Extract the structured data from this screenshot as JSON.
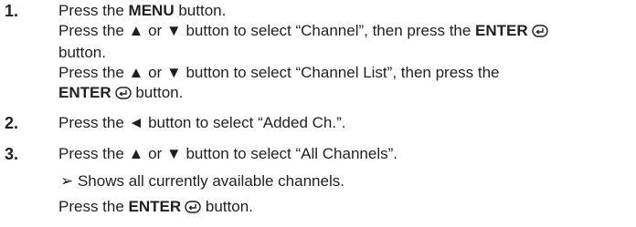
{
  "steps": [
    {
      "number": "1.",
      "lines": [
        {
          "a": "Press the ",
          "b": "MENU",
          "c": " button."
        },
        {
          "a": "Press the ▲ or ▼ button to select “Channel”, then press the ",
          "b": "ENTER",
          "c": ""
        },
        {
          "a": "button."
        },
        {
          "a": "Press the ▲ or ▼ button to select “Channel List”, then press the"
        },
        {
          "b": "ENTER",
          "c": " button."
        }
      ]
    },
    {
      "number": "2.",
      "lines": [
        {
          "a": "Press the ◄ button to select “Added Ch.”."
        }
      ]
    },
    {
      "number": "3.",
      "lines": [
        {
          "a": "Press the ▲ or ▼ button to select “All Channels”."
        }
      ],
      "note": "➢ Shows all currently available channels.",
      "final": {
        "a": "Press the ",
        "b": "ENTER",
        "c": " button."
      }
    }
  ],
  "icons": {
    "enter": "enter-icon"
  }
}
